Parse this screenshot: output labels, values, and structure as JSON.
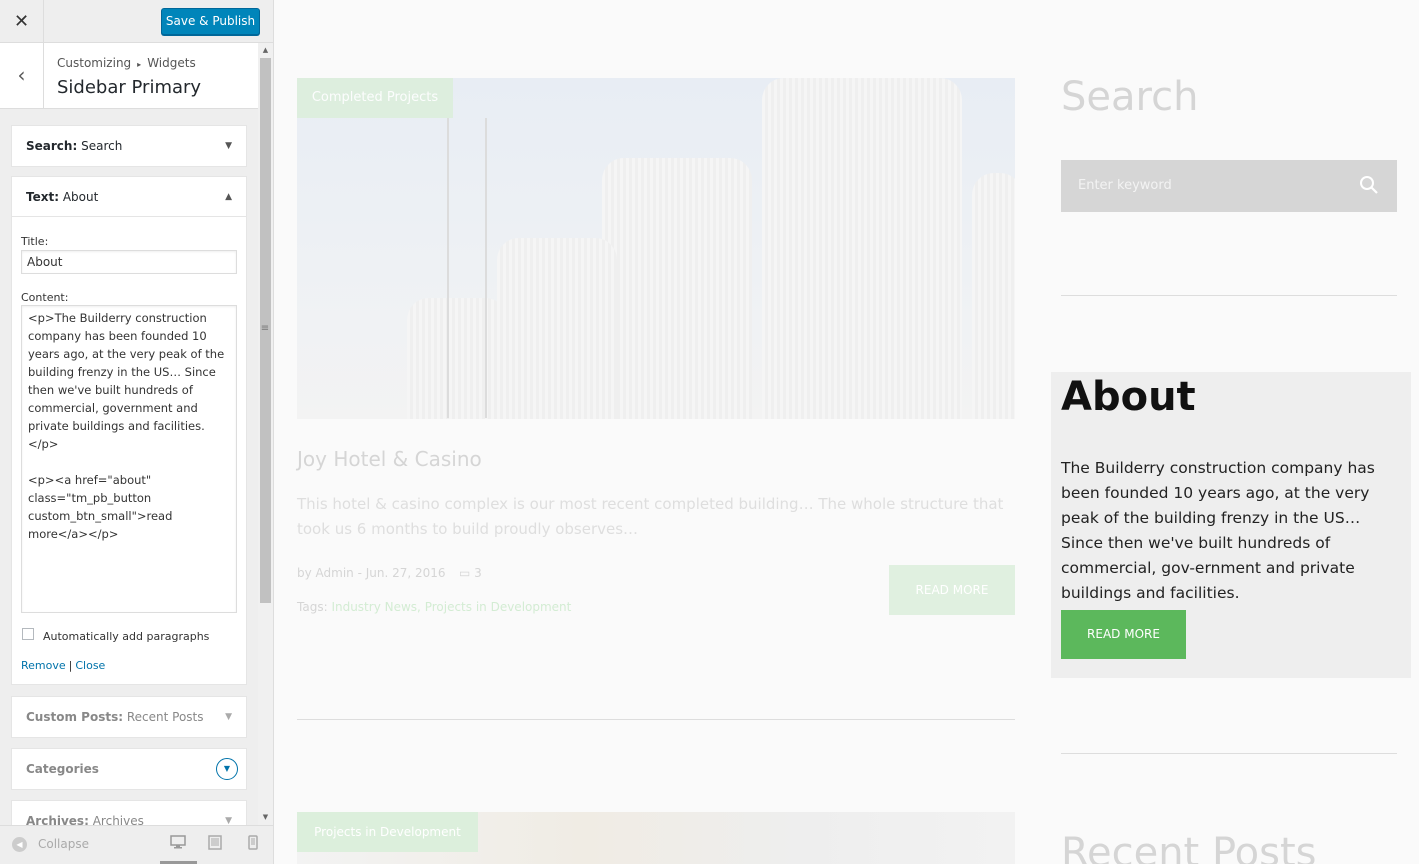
{
  "header": {
    "close_icon": "close-icon",
    "publish_label": "Save & Publish"
  },
  "section": {
    "breadcrumb_root": "Customizing",
    "breadcrumb_child": "Widgets",
    "title": "Sidebar Primary"
  },
  "widgets": {
    "search": {
      "type": "Search:",
      "name": "Search"
    },
    "text": {
      "type": "Text:",
      "name": "About",
      "title_label": "Title:",
      "title_value": "About",
      "content_label": "Content:",
      "content_value": "<p>The Builderry construction company has been founded 10 years ago, at the very peak of the building frenzy in the US… Since then we've built hundreds of commercial, government and private buildings and facilities.</p>\n\n<p><a href=\"about\" class=\"tm_pb_button custom_btn_small\">read more</a></p>",
      "autop_label": "Automatically add paragraphs",
      "autop_checked": false,
      "remove_label": "Remove",
      "separator": "|",
      "close_label": "Close"
    },
    "custom_posts": {
      "type": "Custom Posts:",
      "name": "Recent Posts"
    },
    "categories": {
      "name": "Categories"
    },
    "archives": {
      "type": "Archives:",
      "name": "Archives"
    }
  },
  "footer": {
    "collapse_label": "Collapse",
    "devices": [
      "desktop",
      "tablet",
      "mobile"
    ]
  },
  "preview": {
    "post": {
      "category": "Completed Projects",
      "title": "Joy Hotel & Casino",
      "excerpt": "This hotel & casino complex is our most recent completed building… The whole structure that took us 6 months to build proudly observes…",
      "meta": "by Admin - Jun. 27, 2016",
      "comments": "3",
      "tags_label": "Tags:",
      "tag1": "Industry News",
      "tag_sep": ",",
      "tag2": "Projects in Development",
      "read_more": "READ MORE"
    },
    "next_post_category": "Projects in Development",
    "sidebar": {
      "search_title": "Search",
      "search_placeholder": "Enter keyword",
      "about_title": "About",
      "about_text": "The Builderry construction company has been founded 10 years ago, at the very peak of the building frenzy in the US… Since then we've built hundreds of commercial, gov-ernment and private buildings and facilities.",
      "about_button": "READ MORE",
      "recent_title": "Recent Posts"
    }
  },
  "colors": {
    "primary_button": "#0085ba",
    "link": "#0073aa",
    "accent_green": "#5cb85c"
  }
}
